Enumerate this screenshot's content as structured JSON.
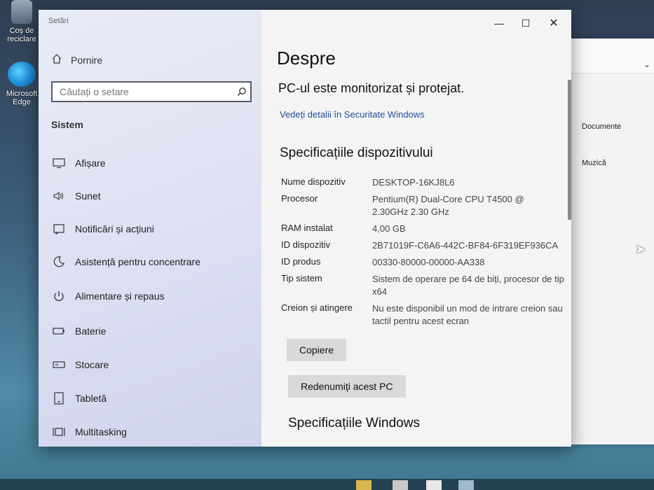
{
  "desktop": {
    "recycle_label": "Coș de reciclare",
    "edge_label": "Microsoft Edge"
  },
  "explorer": {
    "item1": "Documente",
    "item2": "Muzică"
  },
  "window": {
    "title": "Setări",
    "min_symbol": "—",
    "max_symbol": "☐",
    "close_symbol": "✕"
  },
  "sidebar": {
    "home_label": "Pornire",
    "search_placeholder": "Căutați o setare",
    "section_label": "Sistem",
    "items": [
      {
        "label": "Afișare",
        "icon": "monitor-icon"
      },
      {
        "label": "Sunet",
        "icon": "speaker-icon"
      },
      {
        "label": "Notificări și acțiuni",
        "icon": "notification-icon"
      },
      {
        "label": "Asistență pentru concentrare",
        "icon": "moon-icon"
      },
      {
        "label": "Alimentare și repaus",
        "icon": "power-icon"
      },
      {
        "label": "Baterie",
        "icon": "battery-icon"
      },
      {
        "label": "Stocare",
        "icon": "storage-icon"
      },
      {
        "label": "Tabletă",
        "icon": "tablet-icon"
      },
      {
        "label": "Multitasking",
        "icon": "multitasking-icon"
      }
    ]
  },
  "main": {
    "title": "Despre",
    "protected_text": "PC-ul este monitorizat și protejat.",
    "details_link": "Vedeți detalii în Securitate Windows",
    "spec_title": "Specificațiile dispozitivului",
    "specs": [
      {
        "key": "Nume dispozitiv",
        "value": "DESKTOP-16KJ8L6"
      },
      {
        "key": "Procesor",
        "value": "Pentium(R) Dual-Core CPU T4500 @ 2.30GHz 2.30 GHz"
      },
      {
        "key": "RAM instalat",
        "value": "4,00 GB"
      },
      {
        "key": "ID dispozitiv",
        "value": "2B71019F-C6A6-442C-BF84-6F319EF936CA"
      },
      {
        "key": "ID produs",
        "value": "00330-80000-00000-AA338"
      },
      {
        "key": "Tip sistem",
        "value": "Sistem de operare pe 64 de biți, procesor de tip x64"
      },
      {
        "key": "Creion și atingere",
        "value": "Nu este disponibil un mod de intrare creion sau tactil pentru acest ecran"
      }
    ],
    "copy_button": "Copiere",
    "rename_button": "Redenumiți acest PC",
    "windows_spec_title": "Specificațiile Windows"
  }
}
